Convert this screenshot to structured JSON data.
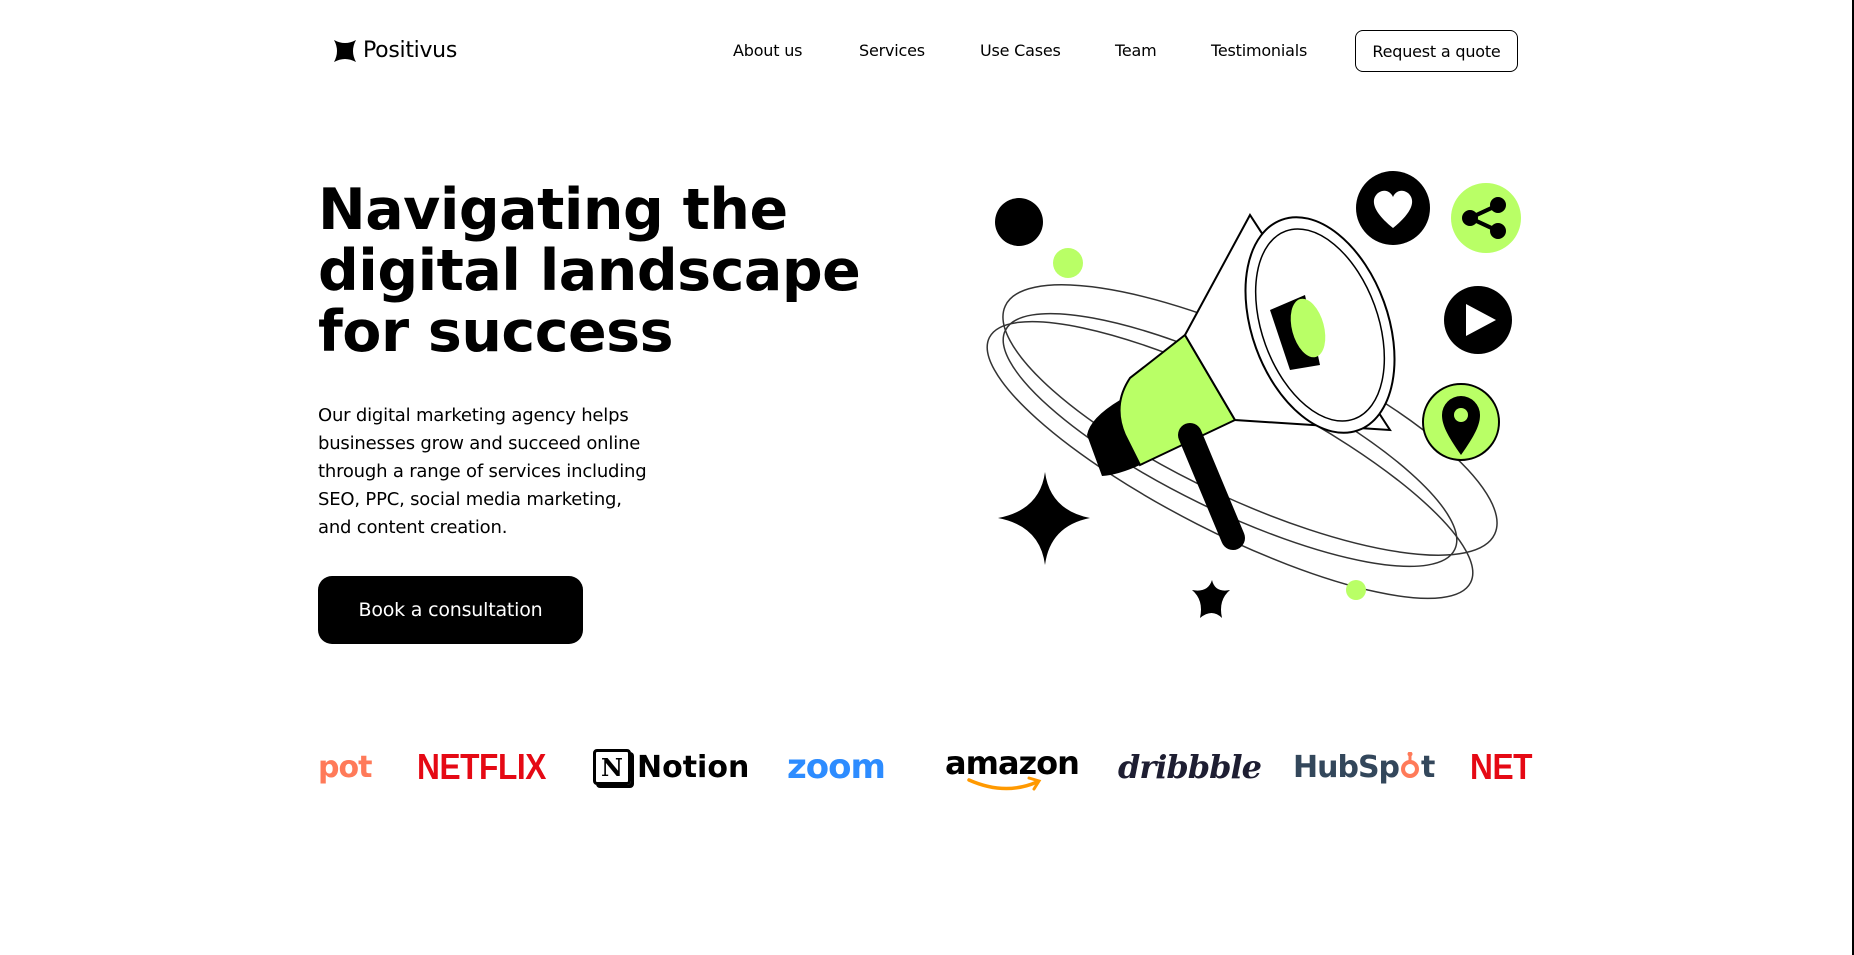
{
  "header": {
    "logo_text": "Positivus",
    "nav": [
      {
        "label": "About us"
      },
      {
        "label": "Services"
      },
      {
        "label": "Use Cases"
      },
      {
        "label": "Team"
      },
      {
        "label": "Testimonials"
      }
    ],
    "cta_label": "Request a quote"
  },
  "hero": {
    "title_lines": [
      "Navigating the",
      "digital landscape",
      "for success"
    ],
    "description_lines": [
      "Our digital marketing agency helps",
      "businesses grow and succeed online",
      "through a range of services including",
      "SEO, PPC, social media marketing,",
      "and content creation."
    ],
    "cta_label": "Book a consultation"
  },
  "brands": {
    "hubspot_partial": "pot",
    "netflix": "NETFLIX",
    "notion_mark": "N",
    "notion": "Notion",
    "zoom": "zoom",
    "amazon": "amazon",
    "dribbble": "dribbble",
    "hubspot_hub": "HubSp",
    "hubspot_end": "t",
    "netflix_partial": "NETF"
  },
  "colors": {
    "accent": "#B9FF66",
    "dark": "#000000",
    "netflix": "#E50914",
    "hubspot_text": "#33475B",
    "hubspot_accent": "#FF7A59",
    "zoom": "#2D8CFF",
    "amazon_smile": "#FF9900"
  },
  "icons": [
    "logo-star-icon",
    "heart-icon",
    "share-icon",
    "play-icon",
    "location-pin-icon",
    "megaphone-icon",
    "sparkle-icon"
  ]
}
